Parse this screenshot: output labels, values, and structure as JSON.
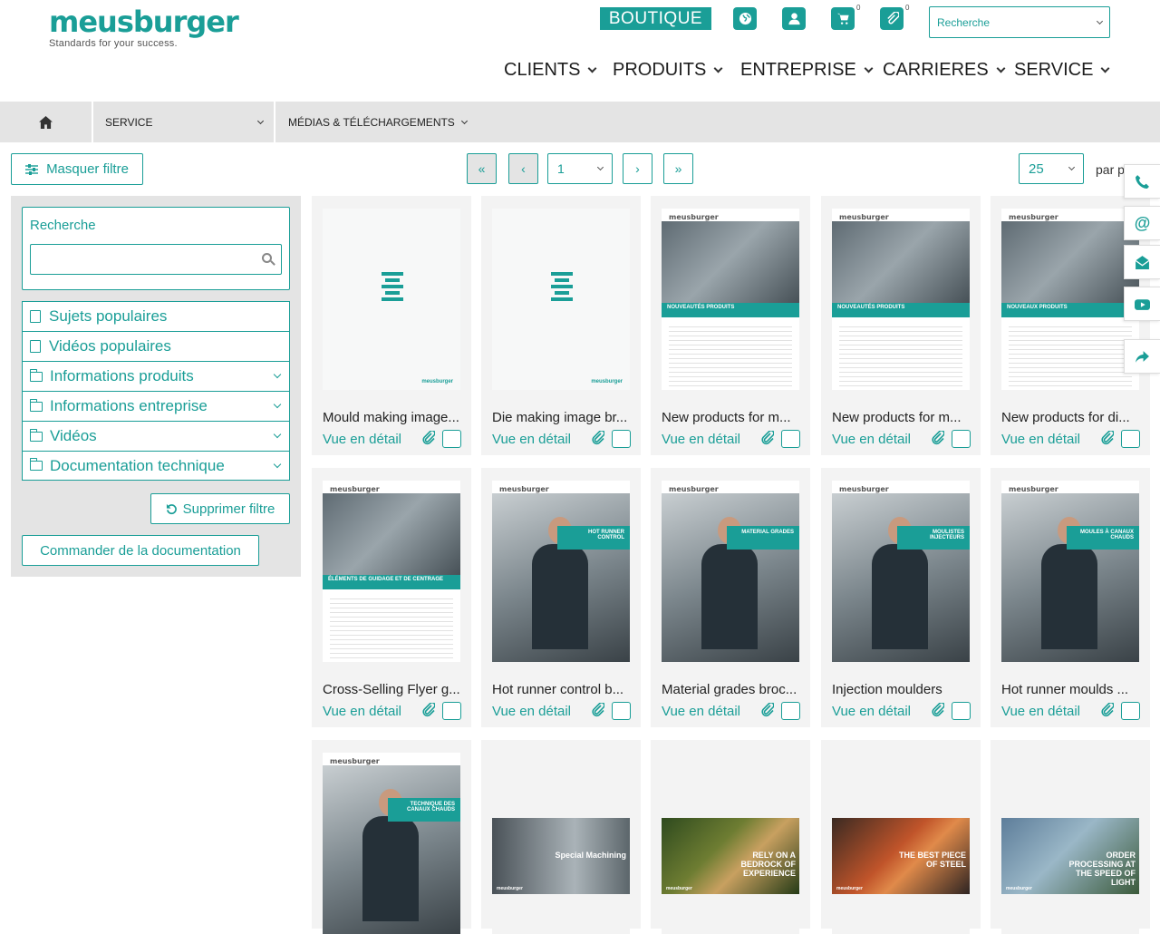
{
  "header": {
    "logo_word": "meusburger",
    "logo_tagline": "Standards for your success.",
    "boutique_label": "BOUTIQUE",
    "cart_count": "0",
    "watchlist_count": "0",
    "search_placeholder": "Recherche",
    "nav": [
      {
        "label": "CLIENTS"
      },
      {
        "label": "PRODUITS"
      },
      {
        "label": "ENTREPRISE"
      },
      {
        "label": "CARRIERES"
      },
      {
        "label": "SERVICE"
      }
    ]
  },
  "breadcrumb": {
    "service_label": "SERVICE",
    "media_label": "MÉDIAS & TÉLÉCHARGEMENTS"
  },
  "controls": {
    "hide_filter_label": "Masquer filtre",
    "page_value": "1",
    "per_page_value": "25",
    "per_page_label": "par p"
  },
  "sidebar": {
    "search_label": "Recherche",
    "filters": [
      {
        "label": "Sujets populaires",
        "icon": "file-icon",
        "expandable": false
      },
      {
        "label": "Vidéos populaires",
        "icon": "file-icon",
        "expandable": false
      },
      {
        "label": "Informations produits",
        "icon": "folder-icon",
        "expandable": true
      },
      {
        "label": "Informations entreprise",
        "icon": "folder-icon",
        "expandable": true
      },
      {
        "label": "Vidéos",
        "icon": "folder-icon",
        "expandable": true
      },
      {
        "label": "Documentation technique",
        "icon": "folder-icon",
        "expandable": true
      }
    ],
    "clear_filter_label": "Supprimer filtre",
    "order_docs_label": "Commander de la documentation"
  },
  "cards": [
    {
      "title": "Mould making image...",
      "link": "Vue en détail",
      "thumb": "logo"
    },
    {
      "title": "Die making image br...",
      "link": "Vue en détail",
      "thumb": "logo2"
    },
    {
      "title": "New products for m...",
      "link": "Vue en détail",
      "thumb": "doc",
      "band": "NOUVEAUTÉS PRODUITS"
    },
    {
      "title": "New products for m...",
      "link": "Vue en détail",
      "thumb": "doc",
      "band": "NOUVEAUTÉS PRODUITS"
    },
    {
      "title": "New products for di...",
      "link": "Vue en détail",
      "thumb": "doc",
      "band": "NOUVEAUX PRODUITS"
    },
    {
      "title": "Cross-Selling Flyer g...",
      "link": "Vue en détail",
      "thumb": "doc",
      "band": "ÉLÉMENTS DE GUIDAGE ET DE CENTRAGE"
    },
    {
      "title": "Hot runner control b...",
      "link": "Vue en détail",
      "thumb": "cover",
      "ribbon": "HOT RUNNER CONTROL"
    },
    {
      "title": "Material grades broc...",
      "link": "Vue en détail",
      "thumb": "cover",
      "ribbon": "MATERIAL GRADES"
    },
    {
      "title": "Injection moulders",
      "link": "Vue en détail",
      "thumb": "cover",
      "ribbon": "MOULISTES INJECTEURS"
    },
    {
      "title": "Hot runner moulds ...",
      "link": "Vue en détail",
      "thumb": "cover",
      "ribbon": "MOULES À CANAUX CHAUDS"
    },
    {
      "title": "",
      "link": "",
      "thumb": "cover",
      "ribbon": "TECHNIQUE DES CANAUX CHAUDS"
    },
    {
      "title": "",
      "link": "",
      "thumb": "banner",
      "banner": "Special Machining"
    },
    {
      "title": "",
      "link": "",
      "thumb": "banner",
      "banner": "RELY ON A BEDROCK OF EXPERIENCE"
    },
    {
      "title": "",
      "link": "",
      "thumb": "banner",
      "banner": "THE BEST PIECE OF STEEL"
    },
    {
      "title": "",
      "link": "",
      "thumb": "banner",
      "banner": "ORDER PROCESSING AT THE SPEED OF LIGHT"
    }
  ],
  "colors": {
    "accent": "#1a9e97",
    "panel": "#e4e4e4"
  }
}
